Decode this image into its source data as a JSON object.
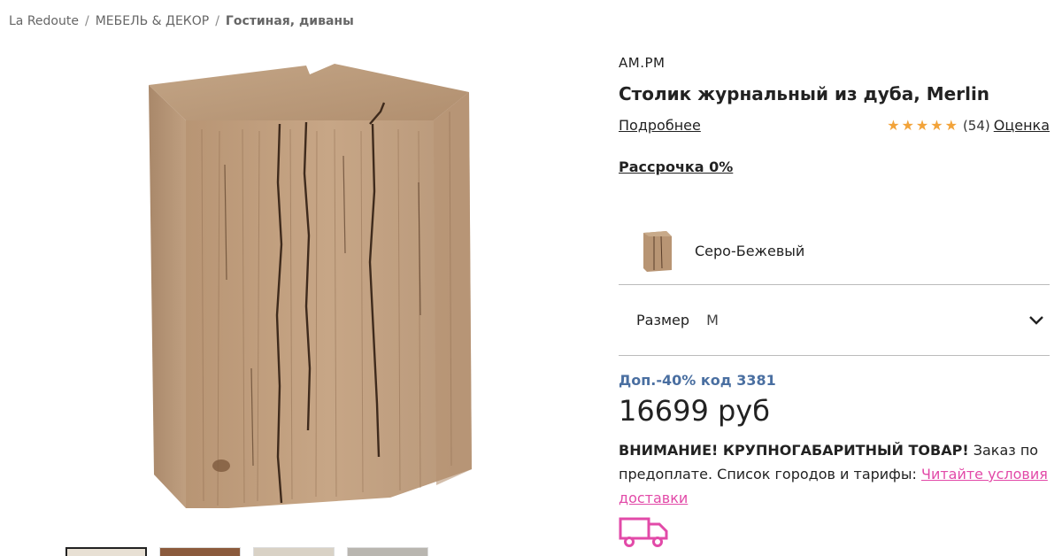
{
  "breadcrumb": {
    "items": [
      "La Redoute",
      "МЕБЕЛЬ & ДЕКОР",
      "Гостиная, диваны"
    ],
    "separator": "/"
  },
  "product": {
    "brand": "AM.PM",
    "title": "Столик журнальный из дуба, Merlin",
    "more_link": "Подробнее",
    "rating": {
      "stars": "★★★★★",
      "value": 4.5,
      "count": "(54)",
      "label": "Оценка",
      "color": "#f2a33a"
    },
    "installments": "Рассрочка 0%",
    "color_option": "Серо-Бежевый",
    "size": {
      "label": "Размер",
      "value": "M"
    },
    "promo": "Доп.-40% код 3381",
    "price": "16699 руб",
    "warning": {
      "bold": "ВНИМАНИЕ! КРУПНОГАБАРИТНЫЙ ТОВАР!",
      "text": " Заказ по предоплате. Список городов и тарифы: ",
      "link": "Читайте условия доставки"
    }
  },
  "colors": {
    "promo": "#4a6fa1",
    "link_pink": "#e24aa8",
    "truck": "#e24aa8"
  },
  "icons": {
    "chevron": "chevron-down-icon",
    "truck": "delivery-truck-icon",
    "star": "star-icon"
  }
}
